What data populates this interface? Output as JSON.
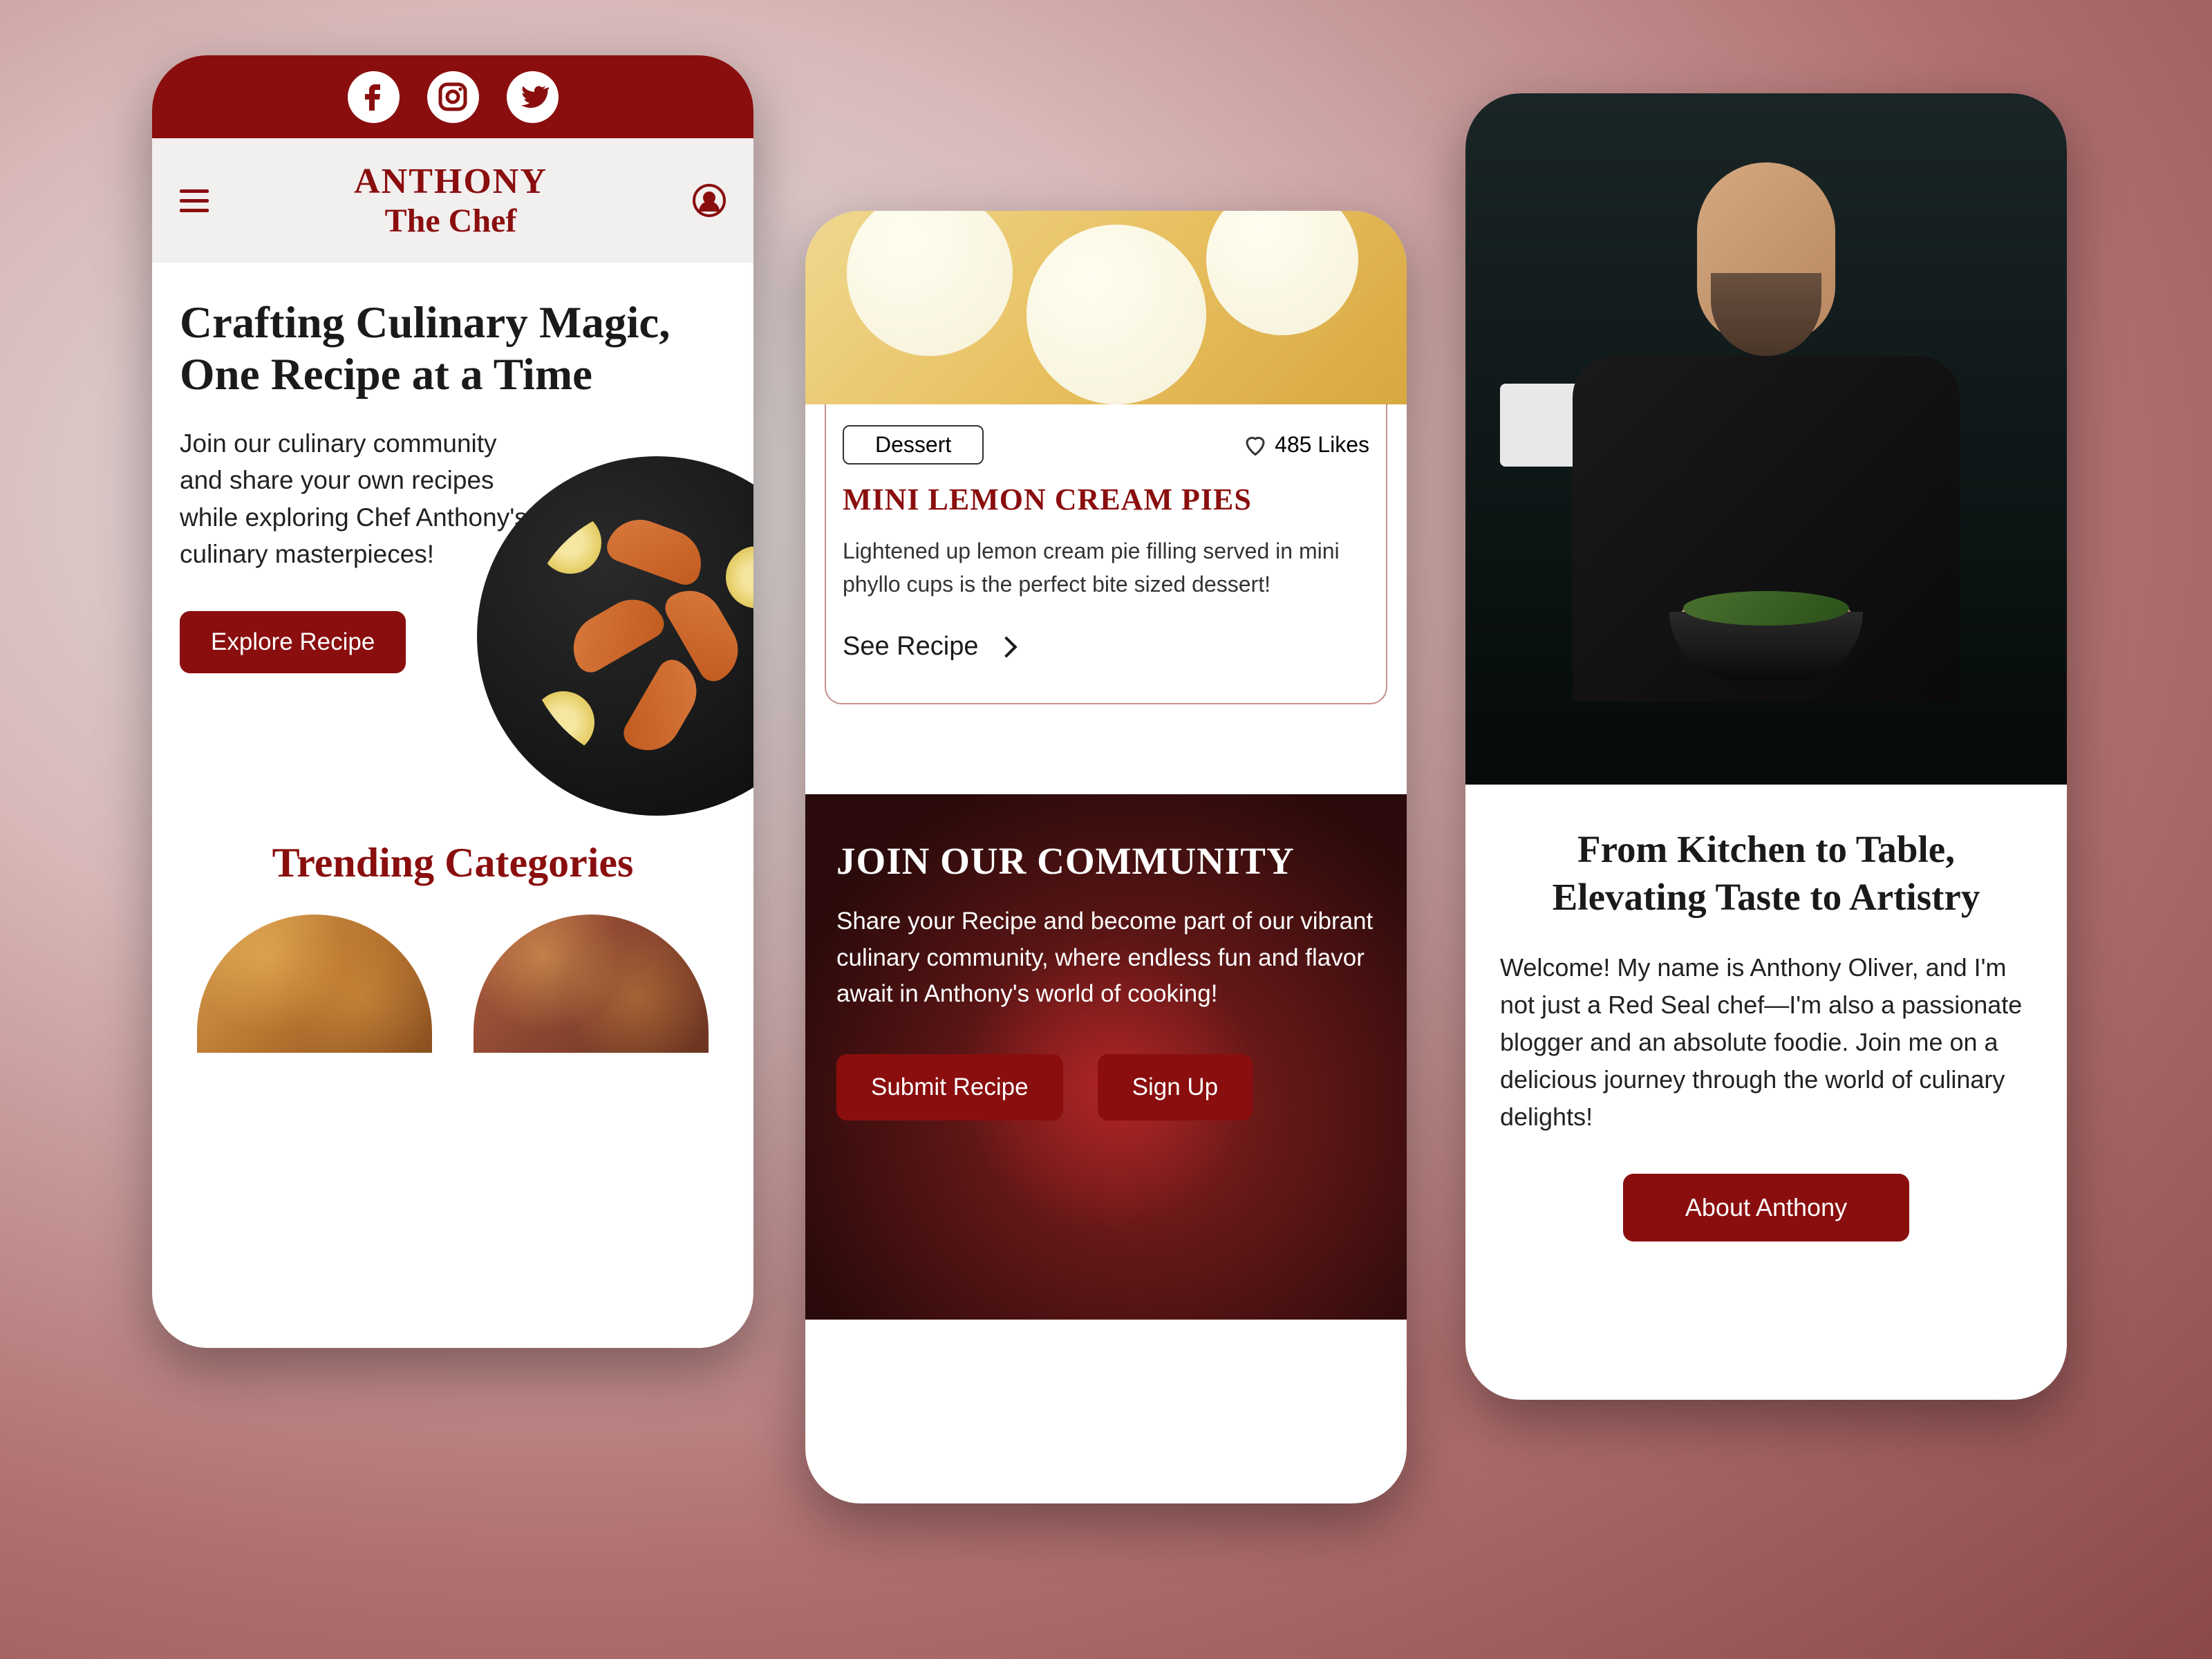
{
  "brand": {
    "line1": "ANTHONY",
    "line2": "The Chef"
  },
  "hero": {
    "title": "Crafting Culinary Magic, One Recipe at a Time",
    "body": "Join our culinary community and share your own recipes while exploring Chef Anthony's culinary masterpieces!",
    "cta": "Explore Recipe"
  },
  "trending": {
    "title": "Trending Categories"
  },
  "recipe": {
    "category": "Dessert",
    "likes": "485 Likes",
    "title": "MINI LEMON CREAM PIES",
    "desc": "Lightened up lemon cream pie filling served in mini phyllo cups is the perfect bite sized dessert!",
    "cta": "See Recipe"
  },
  "community": {
    "title": "JOIN OUR COMMUNITY",
    "body": "Share your Recipe and become part of our vibrant culinary community, where endless fun and flavor await in Anthony's world of cooking!",
    "submit": "Submit  Recipe",
    "signup": "Sign Up"
  },
  "about": {
    "title": "From Kitchen to Table, Elevating Taste to Artistry",
    "body": "Welcome! My name is Anthony Oliver, and I'm not just a Red Seal chef—I'm also a passionate blogger and an absolute foodie. Join me on a delicious journey through the world of culinary delights!",
    "cta": "About Anthony"
  }
}
